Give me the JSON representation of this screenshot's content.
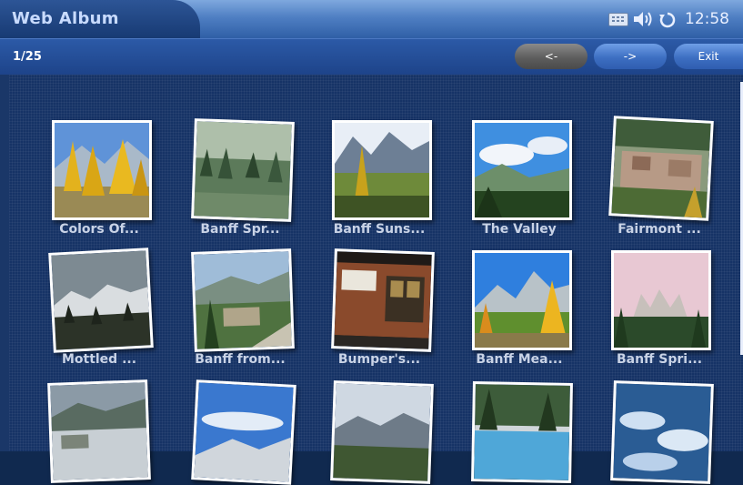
{
  "app": {
    "title": "Web Album"
  },
  "status": {
    "icons": [
      "keyboard-icon",
      "volume-icon",
      "sync-icon"
    ],
    "time": "12:58"
  },
  "toolbar": {
    "page_indicator": "1/25",
    "prev_label": "<-",
    "next_label": "->",
    "exit_label": "Exit"
  },
  "album": {
    "items": [
      {
        "caption": "Colors Of..."
      },
      {
        "caption": "Banff Spr..."
      },
      {
        "caption": "Banff Suns..."
      },
      {
        "caption": "The Valley"
      },
      {
        "caption": "Fairmont ..."
      },
      {
        "caption": "Mottled ..."
      },
      {
        "caption": "Banff from..."
      },
      {
        "caption": "Bumper's..."
      },
      {
        "caption": "Banff Mea..."
      },
      {
        "caption": "Banff Spri..."
      },
      {
        "caption": ""
      },
      {
        "caption": ""
      },
      {
        "caption": ""
      },
      {
        "caption": ""
      },
      {
        "caption": ""
      }
    ]
  },
  "colors": {
    "titlebar": "#4f7fc3",
    "toolbar": "#2c5aa7",
    "background": "#163366",
    "caption": "#c9d3e6"
  }
}
